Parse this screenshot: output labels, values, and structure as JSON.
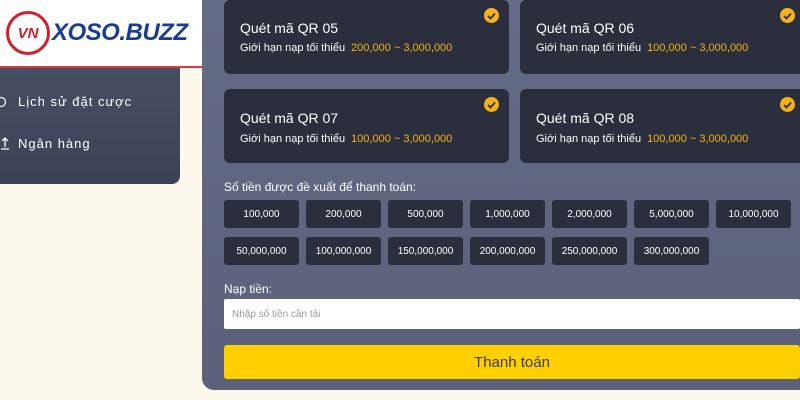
{
  "logo": {
    "mark": "VN",
    "text": "XOSO.BUZZ"
  },
  "sidebar": {
    "items": [
      {
        "label": "Lịch sử đặt cược",
        "icon": "clock-icon"
      },
      {
        "label": "Ngân hàng",
        "icon": "bank-icon"
      }
    ]
  },
  "qr_cards": [
    {
      "title": "Quét mã QR 05",
      "limit_label": "Giới hạn nạp tối thiểu",
      "range": "200,000 ~ 3,000,000",
      "selected": true
    },
    {
      "title": "Quét mã QR 06",
      "limit_label": "Giới hạn nạp tối thiểu",
      "range": "100,000 ~ 3,000,000",
      "selected": true
    },
    {
      "title": "Quét mã QR 07",
      "limit_label": "Giới hạn nạp tối thiểu",
      "range": "100,000 ~ 3,000,000",
      "selected": true
    },
    {
      "title": "Quét mã QR 08",
      "limit_label": "Giới hạn nạp tối thiểu",
      "range": "100,000 ~ 3,000,000",
      "selected": true
    }
  ],
  "suggested": {
    "label": "Số tiền được đề xuất để thanh toán:",
    "amounts": [
      "100,000",
      "200,000",
      "500,000",
      "1,000,000",
      "2,000,000",
      "5,000,000",
      "10,000,000",
      "50,000,000",
      "100,000,000",
      "150,000,000",
      "200,000,000",
      "250,000,000",
      "300,000,000"
    ]
  },
  "deposit": {
    "label": "Nạp tiền:",
    "placeholder": "Nhập số tiền cần tải",
    "value": ""
  },
  "pay_button": {
    "label": "Thanh toán"
  },
  "colors": {
    "accent": "#f5b21b",
    "button_yellow": "#ffd000",
    "card_bg": "#2b2f3d",
    "panel_bg": "#5f6580",
    "page_bg": "#fdf8ec",
    "logo_red": "#d21f2b",
    "logo_blue": "#1b3c8f"
  }
}
